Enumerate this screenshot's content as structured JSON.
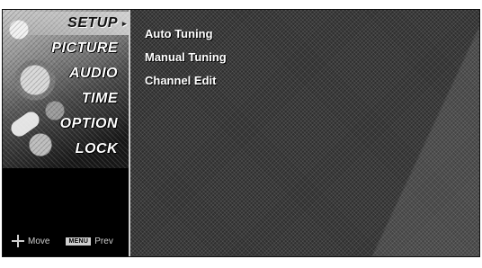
{
  "main_menu": {
    "items": [
      {
        "label": "SETUP",
        "active": true
      },
      {
        "label": "PICTURE",
        "active": false
      },
      {
        "label": "AUDIO",
        "active": false
      },
      {
        "label": "TIME",
        "active": false
      },
      {
        "label": "OPTION",
        "active": false
      },
      {
        "label": "LOCK",
        "active": false
      }
    ],
    "active_marker": "▸"
  },
  "submenu": {
    "items": [
      {
        "label": "Auto Tuning"
      },
      {
        "label": "Manual Tuning"
      },
      {
        "label": "Channel Edit"
      }
    ]
  },
  "help_bar": {
    "move_icon": "four-way-arrow-icon",
    "move_label": "Move",
    "prev_key": "MENU",
    "prev_label": "Prev"
  },
  "colors": {
    "background": "#2a2a2a",
    "text": "#ffffff",
    "sidebar_border": "#cfcfcf"
  }
}
